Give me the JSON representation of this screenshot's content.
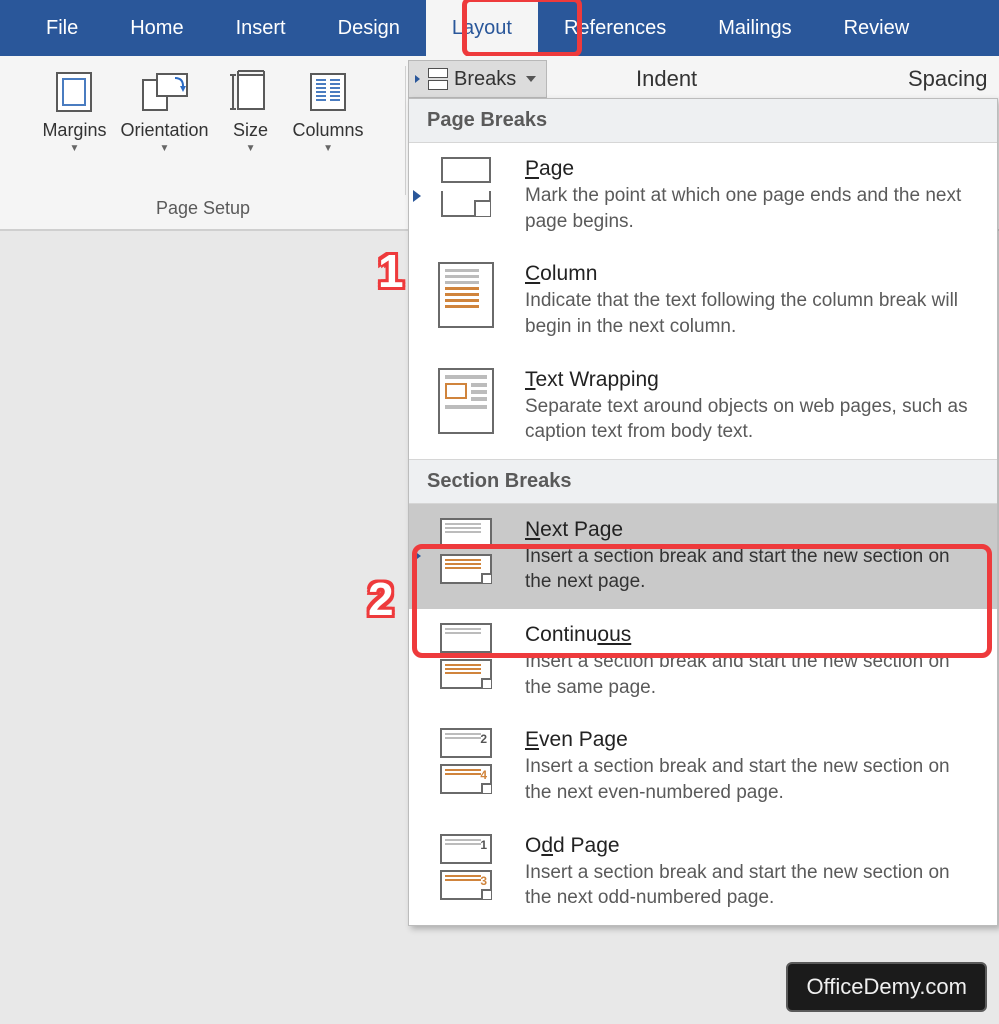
{
  "tabs": [
    "File",
    "Home",
    "Insert",
    "Design",
    "Layout",
    "References",
    "Mailings",
    "Review"
  ],
  "active_tab": "Layout",
  "ribbon": {
    "page_setup": {
      "label": "Page Setup",
      "controls": {
        "margins": "Margins",
        "orientation": "Orientation",
        "size": "Size",
        "columns": "Columns"
      }
    },
    "breaks_button": "Breaks",
    "header_labels": {
      "indent": "Indent",
      "spacing": "Spacing"
    }
  },
  "gallery": {
    "page_breaks_header": "Page Breaks",
    "section_breaks_header": "Section Breaks",
    "items": {
      "page": {
        "title_prefix": "P",
        "title_rest": "age",
        "desc": "Mark the point at which one page ends and the next page begins."
      },
      "column": {
        "title_prefix": "C",
        "title_rest": "olumn",
        "desc": "Indicate that the text following the column break will begin in the next column."
      },
      "textwrap": {
        "title_prefix": "T",
        "title_rest": "ext Wrapping",
        "desc": "Separate text around objects on web pages, such as caption text from body text."
      },
      "next_page": {
        "title_prefix": "N",
        "title_rest": "ext Page",
        "desc": "Insert a section break and start the new section on the next page."
      },
      "continuous": {
        "title_prefix": "Continu",
        "title_rest": "ous",
        "desc": "Insert a section break and start the new section on the same page."
      },
      "even_page": {
        "title_prefix": "E",
        "title_rest": "ven Page",
        "desc": "Insert a section break and start the new section on the next even-numbered page."
      },
      "odd_page": {
        "title_prefix": "O",
        "title_rest": "dd Page",
        "desc": "Insert a section break and start the new section on the next odd-numbered page."
      }
    }
  },
  "callouts": {
    "one": "1",
    "two": "2"
  },
  "watermark": "OfficeDemy.com"
}
